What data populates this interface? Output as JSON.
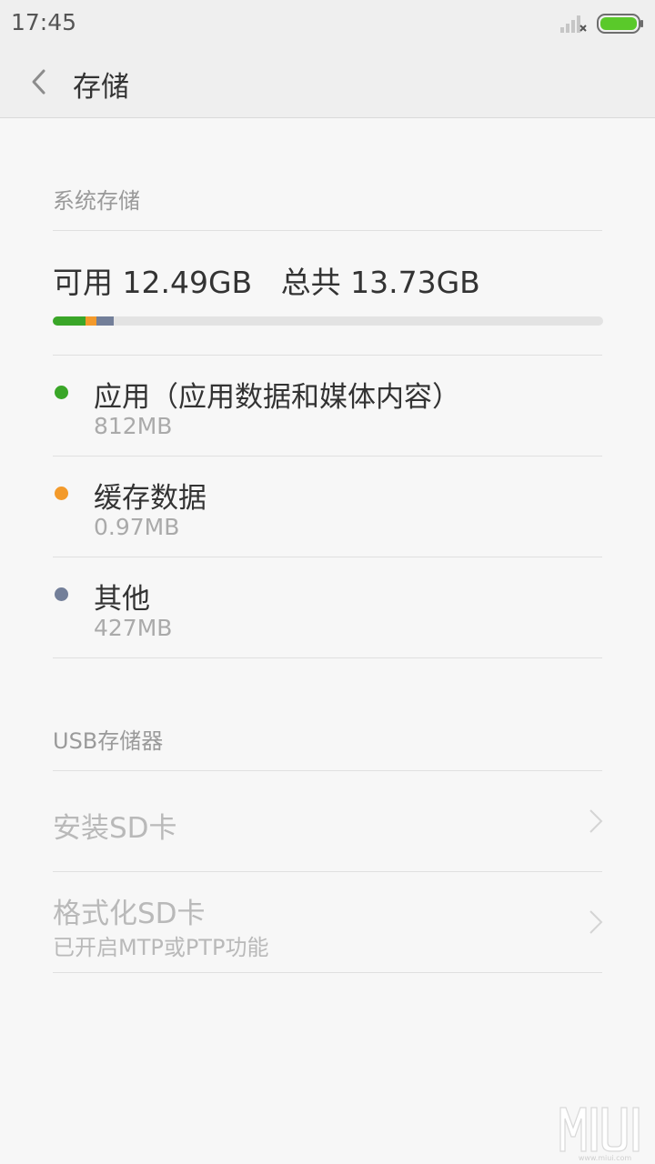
{
  "status_bar": {
    "time": "17:45",
    "icons": [
      "signal-icon",
      "battery-icon"
    ],
    "battery_color": "#5ac92a"
  },
  "header": {
    "back_icon": "back-icon",
    "title": "存储"
  },
  "system_storage": {
    "section_title": "系统存储",
    "summary": "可用 12.49GB   总共 13.73GB",
    "usage_fractions": {
      "apps": 0.059,
      "cache": 0.02,
      "other": 0.031
    },
    "items": [
      {
        "label": "应用（应用数据和媒体内容）",
        "size": "812MB",
        "color": "#3aa628"
      },
      {
        "label": "缓存数据",
        "size": "0.97MB",
        "color": "#f39a2b"
      },
      {
        "label": "其他",
        "size": "427MB",
        "color": "#737f99"
      }
    ]
  },
  "usb_storage": {
    "section_title": "USB存储器",
    "items": [
      {
        "title": "安装SD卡",
        "subtitle": ""
      },
      {
        "title": "格式化SD卡",
        "subtitle": "已开启MTP或PTP功能"
      }
    ]
  },
  "watermark": {
    "logo_text": "MIUI",
    "url": "www.miui.com"
  }
}
